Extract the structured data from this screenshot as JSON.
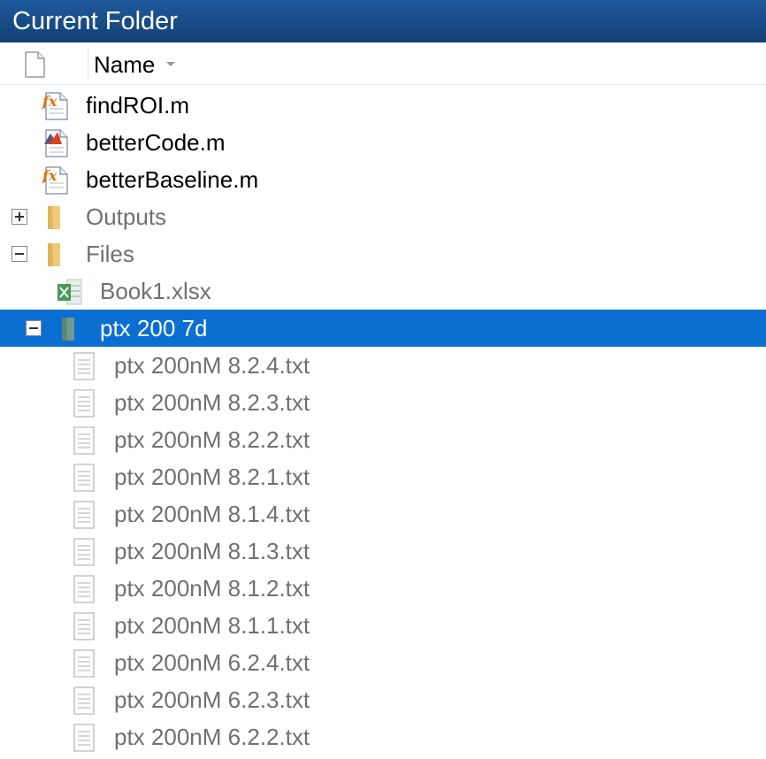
{
  "panel": {
    "title": "Current Folder"
  },
  "header": {
    "name_label": "Name",
    "file_header_icon": "blank-page-icon",
    "sort_icon": "sort-down-icon"
  },
  "colors": {
    "titlebar": "#1a4f8a",
    "selection": "#0a6fd1",
    "folder": "#f2c97a",
    "excel": "#4a9a5a",
    "text_dark": "#000000",
    "text_grey": "#707070"
  },
  "files": {
    "top_level": [
      {
        "name": "findROI.m",
        "icon": "matlab-function-icon"
      },
      {
        "name": "betterCode.m",
        "icon": "matlab-script-icon"
      },
      {
        "name": "betterBaseline.m",
        "icon": "matlab-function-icon"
      }
    ],
    "outputs_folder": {
      "name": "Outputs",
      "icon": "folder-icon",
      "expanded": false
    },
    "files_folder": {
      "name": "Files",
      "icon": "folder-icon",
      "expanded": true
    },
    "book": {
      "name": "Book1.xlsx",
      "icon": "excel-file-icon"
    },
    "ptx_folder": {
      "name": "ptx 200 7d",
      "icon": "folder-icon",
      "expanded": true,
      "selected": true
    },
    "txt_files": [
      {
        "name": "ptx 200nM 8.2.4.txt",
        "icon": "text-file-icon"
      },
      {
        "name": "ptx 200nM 8.2.3.txt",
        "icon": "text-file-icon"
      },
      {
        "name": "ptx 200nM 8.2.2.txt",
        "icon": "text-file-icon"
      },
      {
        "name": "ptx 200nM 8.2.1.txt",
        "icon": "text-file-icon"
      },
      {
        "name": "ptx 200nM 8.1.4.txt",
        "icon": "text-file-icon"
      },
      {
        "name": "ptx 200nM 8.1.3.txt",
        "icon": "text-file-icon"
      },
      {
        "name": "ptx 200nM 8.1.2.txt",
        "icon": "text-file-icon"
      },
      {
        "name": "ptx 200nM 8.1.1.txt",
        "icon": "text-file-icon"
      },
      {
        "name": "ptx 200nM 6.2.4.txt",
        "icon": "text-file-icon"
      },
      {
        "name": "ptx 200nM 6.2.3.txt",
        "icon": "text-file-icon"
      },
      {
        "name": "ptx 200nM 6.2.2.txt",
        "icon": "text-file-icon"
      }
    ]
  }
}
